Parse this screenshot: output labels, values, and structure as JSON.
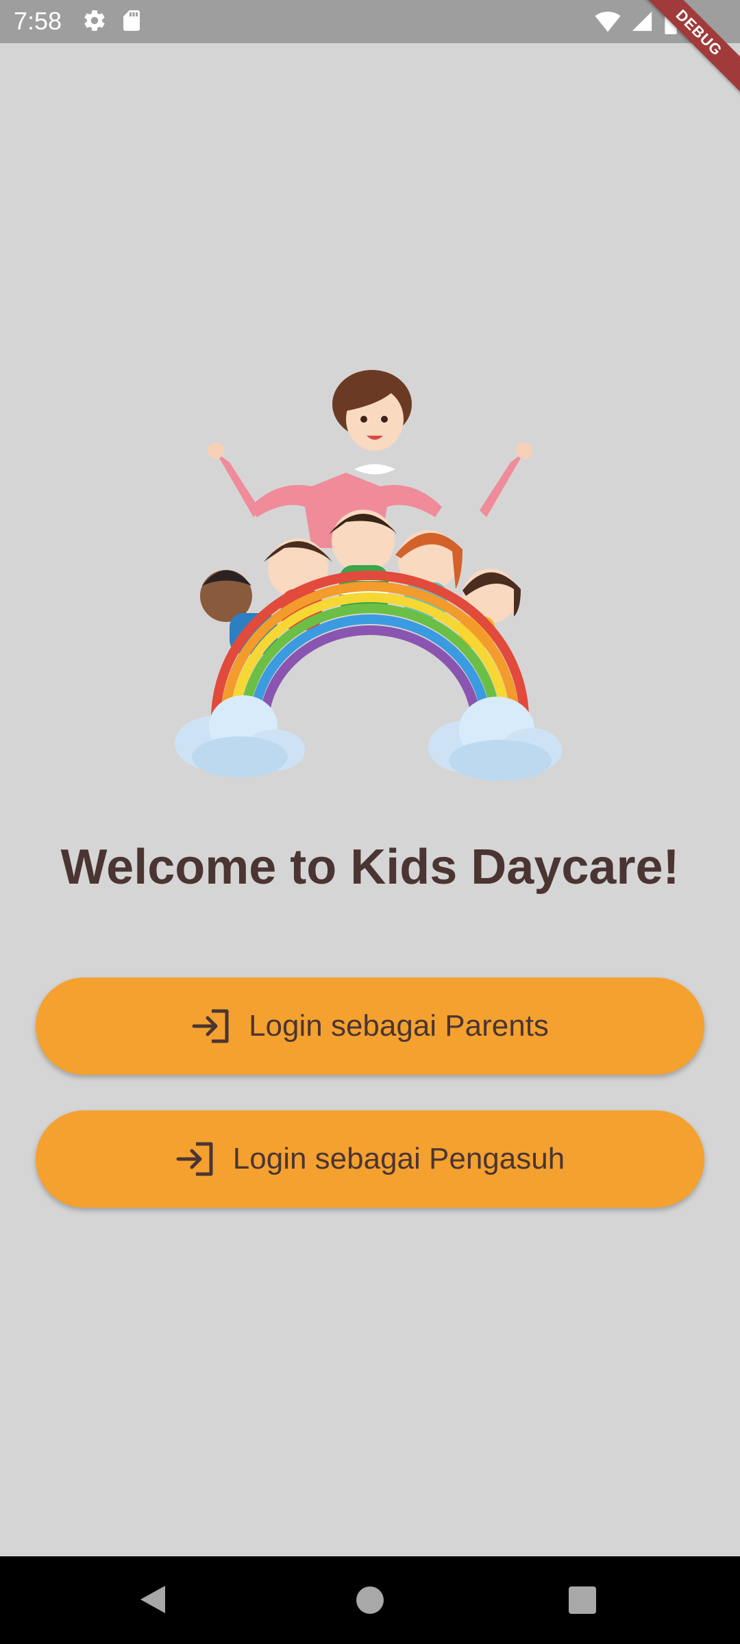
{
  "status_bar": {
    "time": "7:58",
    "left_icons": [
      "gear-icon",
      "sd-card-icon"
    ],
    "right_icons": [
      "wifi-icon",
      "signal-icon",
      "battery-icon"
    ],
    "debug_banner": "DEBUG"
  },
  "illustration": {
    "icon": "kids-daycare-illustration"
  },
  "welcome": {
    "title": "Welcome to Kids Daycare!"
  },
  "buttons": {
    "parents": {
      "label": "Login sebagai Parents",
      "icon": "login-icon"
    },
    "pengasuh": {
      "label": "Login sebagai Pengasuh",
      "icon": "login-icon"
    }
  },
  "nav_bar": {
    "icons": [
      "back-icon",
      "home-icon",
      "recents-icon"
    ]
  },
  "colors": {
    "background": "#d6d5d6",
    "button": "#f5a12f",
    "text": "#4a3533",
    "status_bar": "#9e9e9e"
  }
}
